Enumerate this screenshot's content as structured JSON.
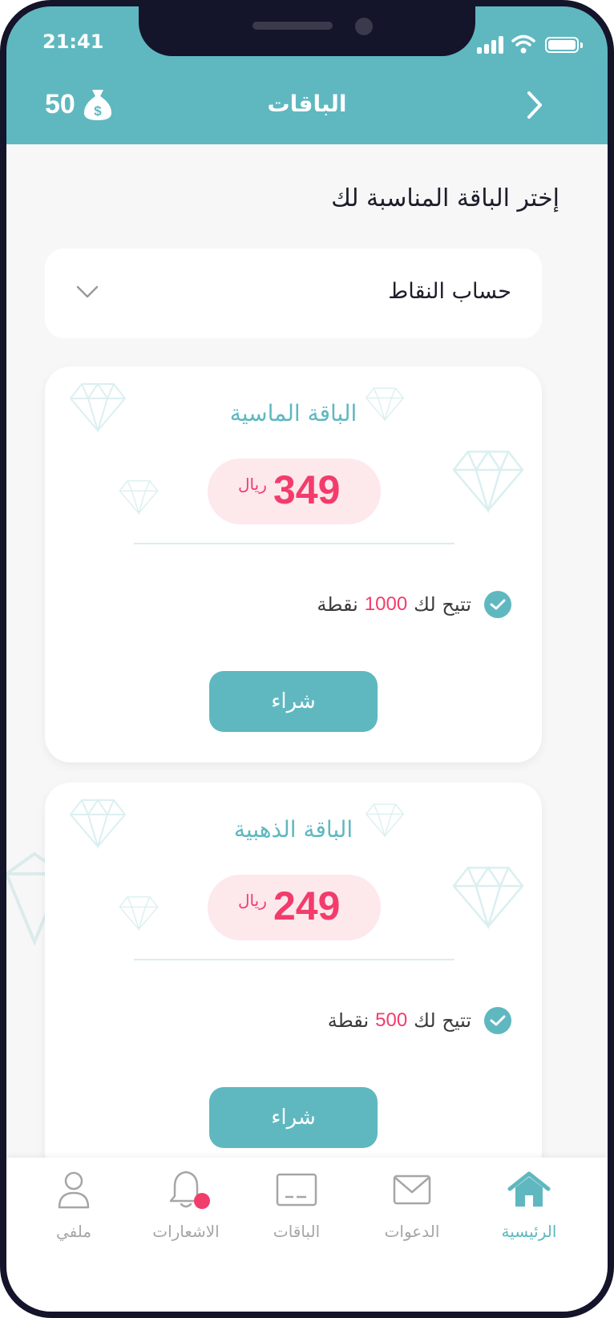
{
  "status_bar": {
    "time": "21:41"
  },
  "header": {
    "title": "الباقات",
    "points_value": "50",
    "back_icon": "chevron-right-icon",
    "points_icon": "money-bag-icon"
  },
  "main": {
    "section_title": "إختر الباقة المناسبة لك",
    "dropdown": {
      "selected": "حساب النقاط"
    },
    "packages": [
      {
        "title": "الباقة الماسية",
        "price": "349",
        "currency": "ريال",
        "feature_prefix": "تتيح لك",
        "feature_points": "1000",
        "feature_suffix": "نقطة",
        "button": "شراء"
      },
      {
        "title": "الباقة الذهبية",
        "price": "249",
        "currency": "ريال",
        "feature_prefix": "تتيح لك",
        "feature_points": "500",
        "feature_suffix": "نقطة",
        "button": "شراء"
      }
    ]
  },
  "tabbar": {
    "items": [
      {
        "label": "ملفي",
        "icon": "user-icon"
      },
      {
        "label": "الاشعارات",
        "icon": "bell-icon"
      },
      {
        "label": "الباقات",
        "icon": "card-icon"
      },
      {
        "label": "الدعوات",
        "icon": "envelope-icon"
      },
      {
        "label": "الرئيسية",
        "icon": "home-icon"
      }
    ],
    "active": "الرئيسية"
  },
  "colors": {
    "primary": "#5fb8c0",
    "accent": "#f23c6b",
    "price_bg": "#fde8ec",
    "background": "#f7f7f7"
  }
}
